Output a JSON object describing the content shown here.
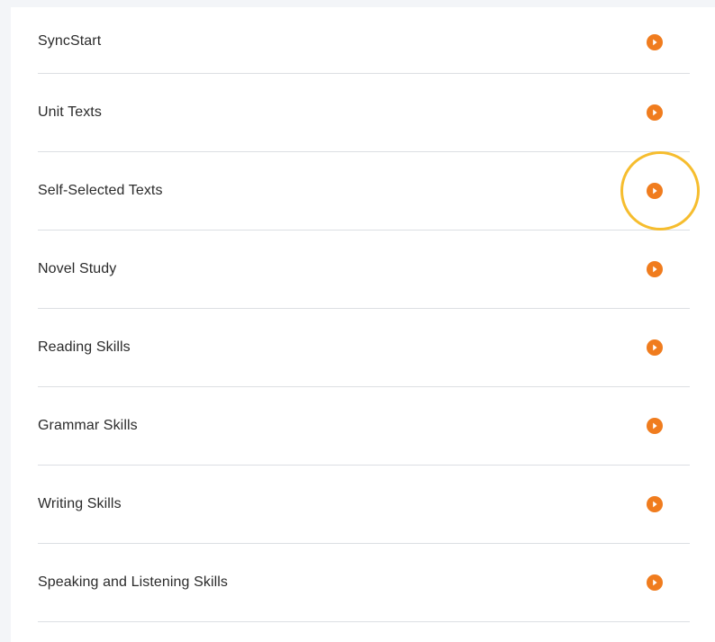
{
  "menu": {
    "items": [
      {
        "label": "SyncStart",
        "icon": "play-arrow-icon",
        "highlighted": false
      },
      {
        "label": "Unit Texts",
        "icon": "play-arrow-icon",
        "highlighted": false
      },
      {
        "label": "Self-Selected Texts",
        "icon": "play-arrow-icon",
        "highlighted": true
      },
      {
        "label": "Novel Study",
        "icon": "play-arrow-icon",
        "highlighted": false
      },
      {
        "label": "Reading Skills",
        "icon": "play-arrow-icon",
        "highlighted": false
      },
      {
        "label": "Grammar Skills",
        "icon": "play-arrow-icon",
        "highlighted": false
      },
      {
        "label": "Writing Skills",
        "icon": "play-arrow-icon",
        "highlighted": false
      },
      {
        "label": "Speaking and Listening Skills",
        "icon": "play-arrow-icon",
        "highlighted": false
      }
    ]
  },
  "colors": {
    "accent": "#f07c1e",
    "highlight_ring": "#f6bd2e",
    "divider": "#dcdfe3",
    "text": "#2b2b2b"
  }
}
